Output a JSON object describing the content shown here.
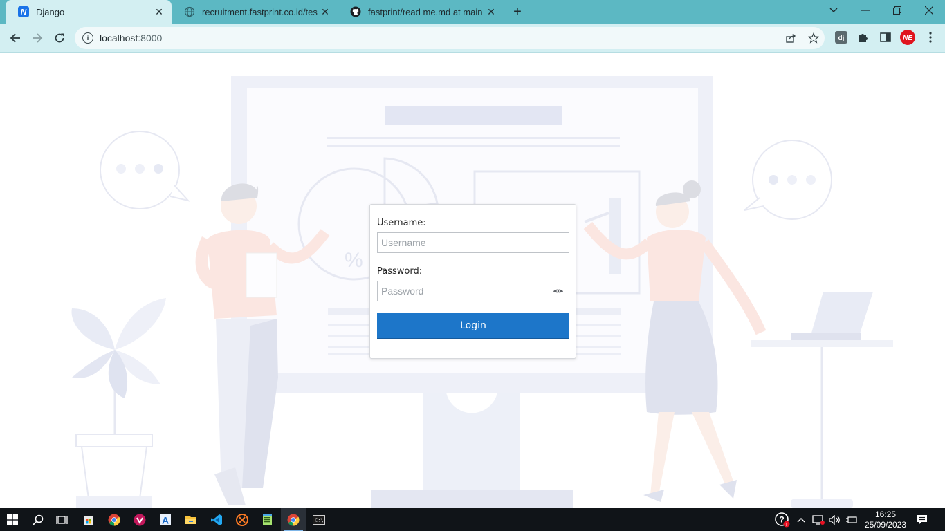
{
  "browser": {
    "tabs": [
      {
        "title": "Django",
        "active": true,
        "favicon": "django-n-icon"
      },
      {
        "title": "recruitment.fastprint.co.id/tes/te",
        "active": false,
        "favicon": "globe-icon"
      },
      {
        "title": "fastprint/read me.md at main · s",
        "active": false,
        "favicon": "github-icon"
      }
    ],
    "url_host": "localhost",
    "url_port": ":8000"
  },
  "login": {
    "username_label": "Username:",
    "username_placeholder": "Username",
    "password_label": "Password:",
    "password_placeholder": "Password",
    "login_button": "Login"
  },
  "taskbar": {
    "time": "16:25",
    "date": "25/09/2023"
  },
  "colors": {
    "tab_strip": "#5cb8c3",
    "toolbar": "#d3eff2",
    "login_button": "#1d76c9",
    "taskbar": "#101418"
  }
}
